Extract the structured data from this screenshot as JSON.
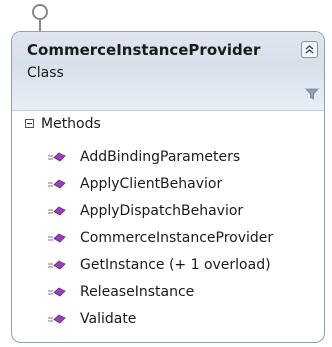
{
  "class": {
    "name": "CommerceInstanceProvider",
    "kind": "Class",
    "collapse_icon": "double-chevron-up-icon",
    "filter_icon": "funnel-icon"
  },
  "section": {
    "label": "Methods",
    "toggle_icon": "minus-box-icon"
  },
  "methods": [
    {
      "label": "AddBindingParameters",
      "icon": "method-icon"
    },
    {
      "label": "ApplyClientBehavior",
      "icon": "method-icon"
    },
    {
      "label": "ApplyDispatchBehavior",
      "icon": "method-icon"
    },
    {
      "label": "CommerceInstanceProvider",
      "icon": "method-icon"
    },
    {
      "label": "GetInstance (+ 1 overload)",
      "icon": "method-icon"
    },
    {
      "label": "ReleaseInstance",
      "icon": "method-icon"
    },
    {
      "label": "Validate",
      "icon": "method-icon"
    }
  ],
  "colors": {
    "border": "#8fa0b6",
    "header_bg": "#dfe6ef",
    "method_icon": "#9b3fb8"
  }
}
